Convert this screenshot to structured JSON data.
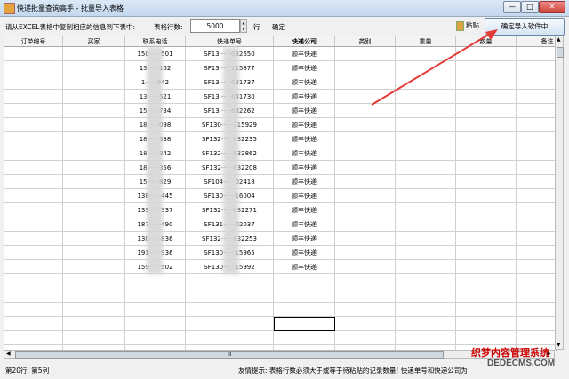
{
  "window": {
    "title": "快递批量查询高手 - 批量导入表格",
    "min_glyph": "—",
    "max_glyph": "□",
    "close_glyph": "✕"
  },
  "toolbar": {
    "instruction": "请从EXCEL表格中复制相应的信息到下表中:",
    "rows_label": "表格行数:",
    "rows_value": "5000",
    "rows_unit": "行",
    "confirm_label": "确定",
    "paste_label": "粘贴",
    "import_label": "确定导入软件中"
  },
  "table": {
    "columns": [
      "订单编号",
      "买家",
      "联系电话",
      "快递单号",
      "快递公司",
      "类别",
      "重量",
      "数量",
      "备注"
    ],
    "rows": [
      {
        "phone": "150······501",
        "tracking": "SF13······632650",
        "company": "顺丰快递"
      },
      {
        "phone": "13······162",
        "tracking": "SF13······215877",
        "company": "顺丰快递"
      },
      {
        "phone": "1······942",
        "tracking": "SF13······631737",
        "company": "顺丰快递"
      },
      {
        "phone": "13······521",
        "tracking": "SF13······641730",
        "company": "顺丰快递"
      },
      {
        "phone": "15······734",
        "tracking": "SF13······632262",
        "company": "顺丰快递"
      },
      {
        "phone": "18······098",
        "tracking": "SF130······215929",
        "company": "顺丰快递"
      },
      {
        "phone": "18······338",
        "tracking": "SF132······632235",
        "company": "顺丰快递"
      },
      {
        "phone": "18······342",
        "tracking": "SF132······632862",
        "company": "顺丰快递"
      },
      {
        "phone": "18······356",
        "tracking": "SF132······632208",
        "company": "顺丰快递"
      },
      {
        "phone": "15······829",
        "tracking": "SF104······02418",
        "company": "顺丰快递"
      },
      {
        "phone": "138······445",
        "tracking": "SF130······16004",
        "company": "顺丰快递"
      },
      {
        "phone": "139······937",
        "tracking": "SF132······632271",
        "company": "顺丰快递"
      },
      {
        "phone": "187······490",
        "tracking": "SF131······02037",
        "company": "顺丰快递"
      },
      {
        "phone": "130······836",
        "tracking": "SF132······632253",
        "company": "顺丰快递"
      },
      {
        "phone": "191······936",
        "tracking": "SF130······15965",
        "company": "顺丰快递"
      },
      {
        "phone": "159······502",
        "tracking": "SF130······15992",
        "company": "顺丰快递"
      }
    ],
    "empty_rows": 6
  },
  "scroll": {
    "up": "▲",
    "down": "▼",
    "left": "◀",
    "right": "▶",
    "grip": "III"
  },
  "status": {
    "position": "第20行, 第5列",
    "tip": "友情提示: 表格行数必须大于或等于待粘贴的记录数量! 快递单号和快递公司为"
  },
  "watermark": {
    "text": "织梦内容管理系统",
    "url": "DEDECMS.COM"
  },
  "colors": {
    "annotation_arrow": "#e53935",
    "watermark": "#cc0000"
  }
}
